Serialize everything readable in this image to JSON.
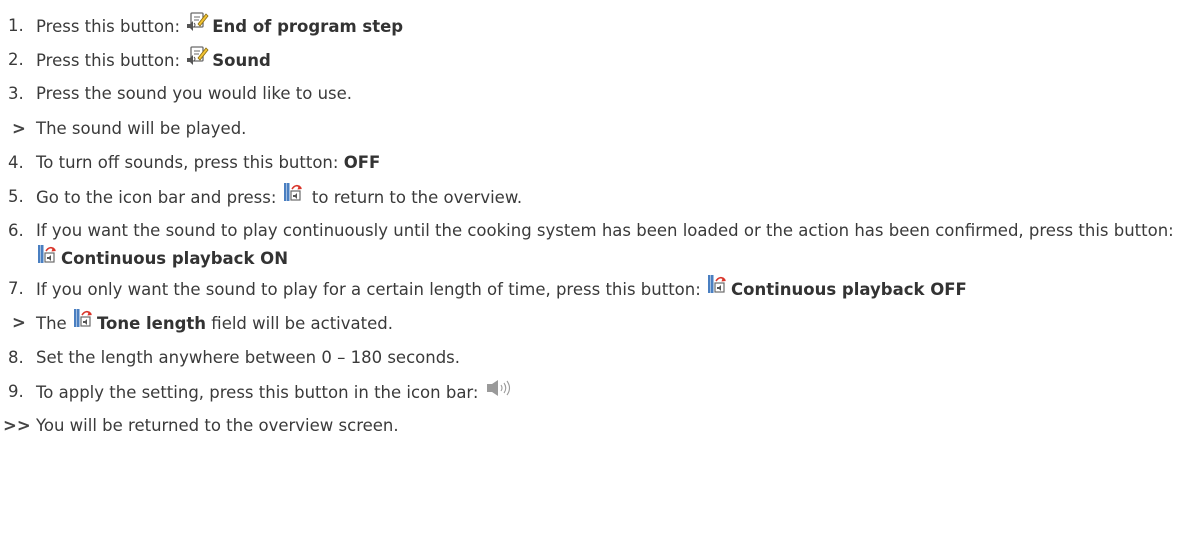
{
  "steps": [
    {
      "marker": "1.",
      "text": "Press this button: ",
      "icon": "edit-sound-icon",
      "button": "End of program step"
    },
    {
      "marker": "2.",
      "text": "Press this button: ",
      "icon": "edit-sound-icon",
      "button": "Sound"
    },
    {
      "marker": "3.",
      "text": "Press the sound you would like to use."
    },
    {
      "marker": ">",
      "text": "The sound will be played."
    },
    {
      "marker": "4.",
      "text": "To turn off sounds, press this button: ",
      "button": "OFF"
    },
    {
      "marker": "5.",
      "text_before": "Go to the icon bar and press: ",
      "icon": "return-sound-icon",
      "text_after": " to return to the overview."
    },
    {
      "marker": "6.",
      "text": "If you want the sound to play continuously until the cooking system has been loaded or the action has been confirmed, press this button: ",
      "icon": "continuous-playback-icon",
      "button": "Continuous playback ON"
    },
    {
      "marker": "7.",
      "text": "If you only want the sound to play for a certain length of time, press this button: ",
      "icon": "continuous-playback-icon",
      "button": "Continuous playback OFF"
    },
    {
      "marker": ">",
      "text_before": "The ",
      "icon": "tone-length-icon",
      "button": "Tone length",
      "text_after": " field will be activated."
    },
    {
      "marker": "8.",
      "text": "Set the length anywhere between 0 – 180 seconds."
    },
    {
      "marker": "9.",
      "text": "To apply the setting, press this button in the icon bar: ",
      "icon": "speaker-sound-icon"
    },
    {
      "marker": ">>",
      "text": "You will be returned to the overview screen."
    }
  ],
  "colors": {
    "text": "#3a3a3a",
    "icon_red": "#d9362b",
    "icon_blue": "#4a7fc1",
    "icon_gray": "#9a9a9a"
  }
}
